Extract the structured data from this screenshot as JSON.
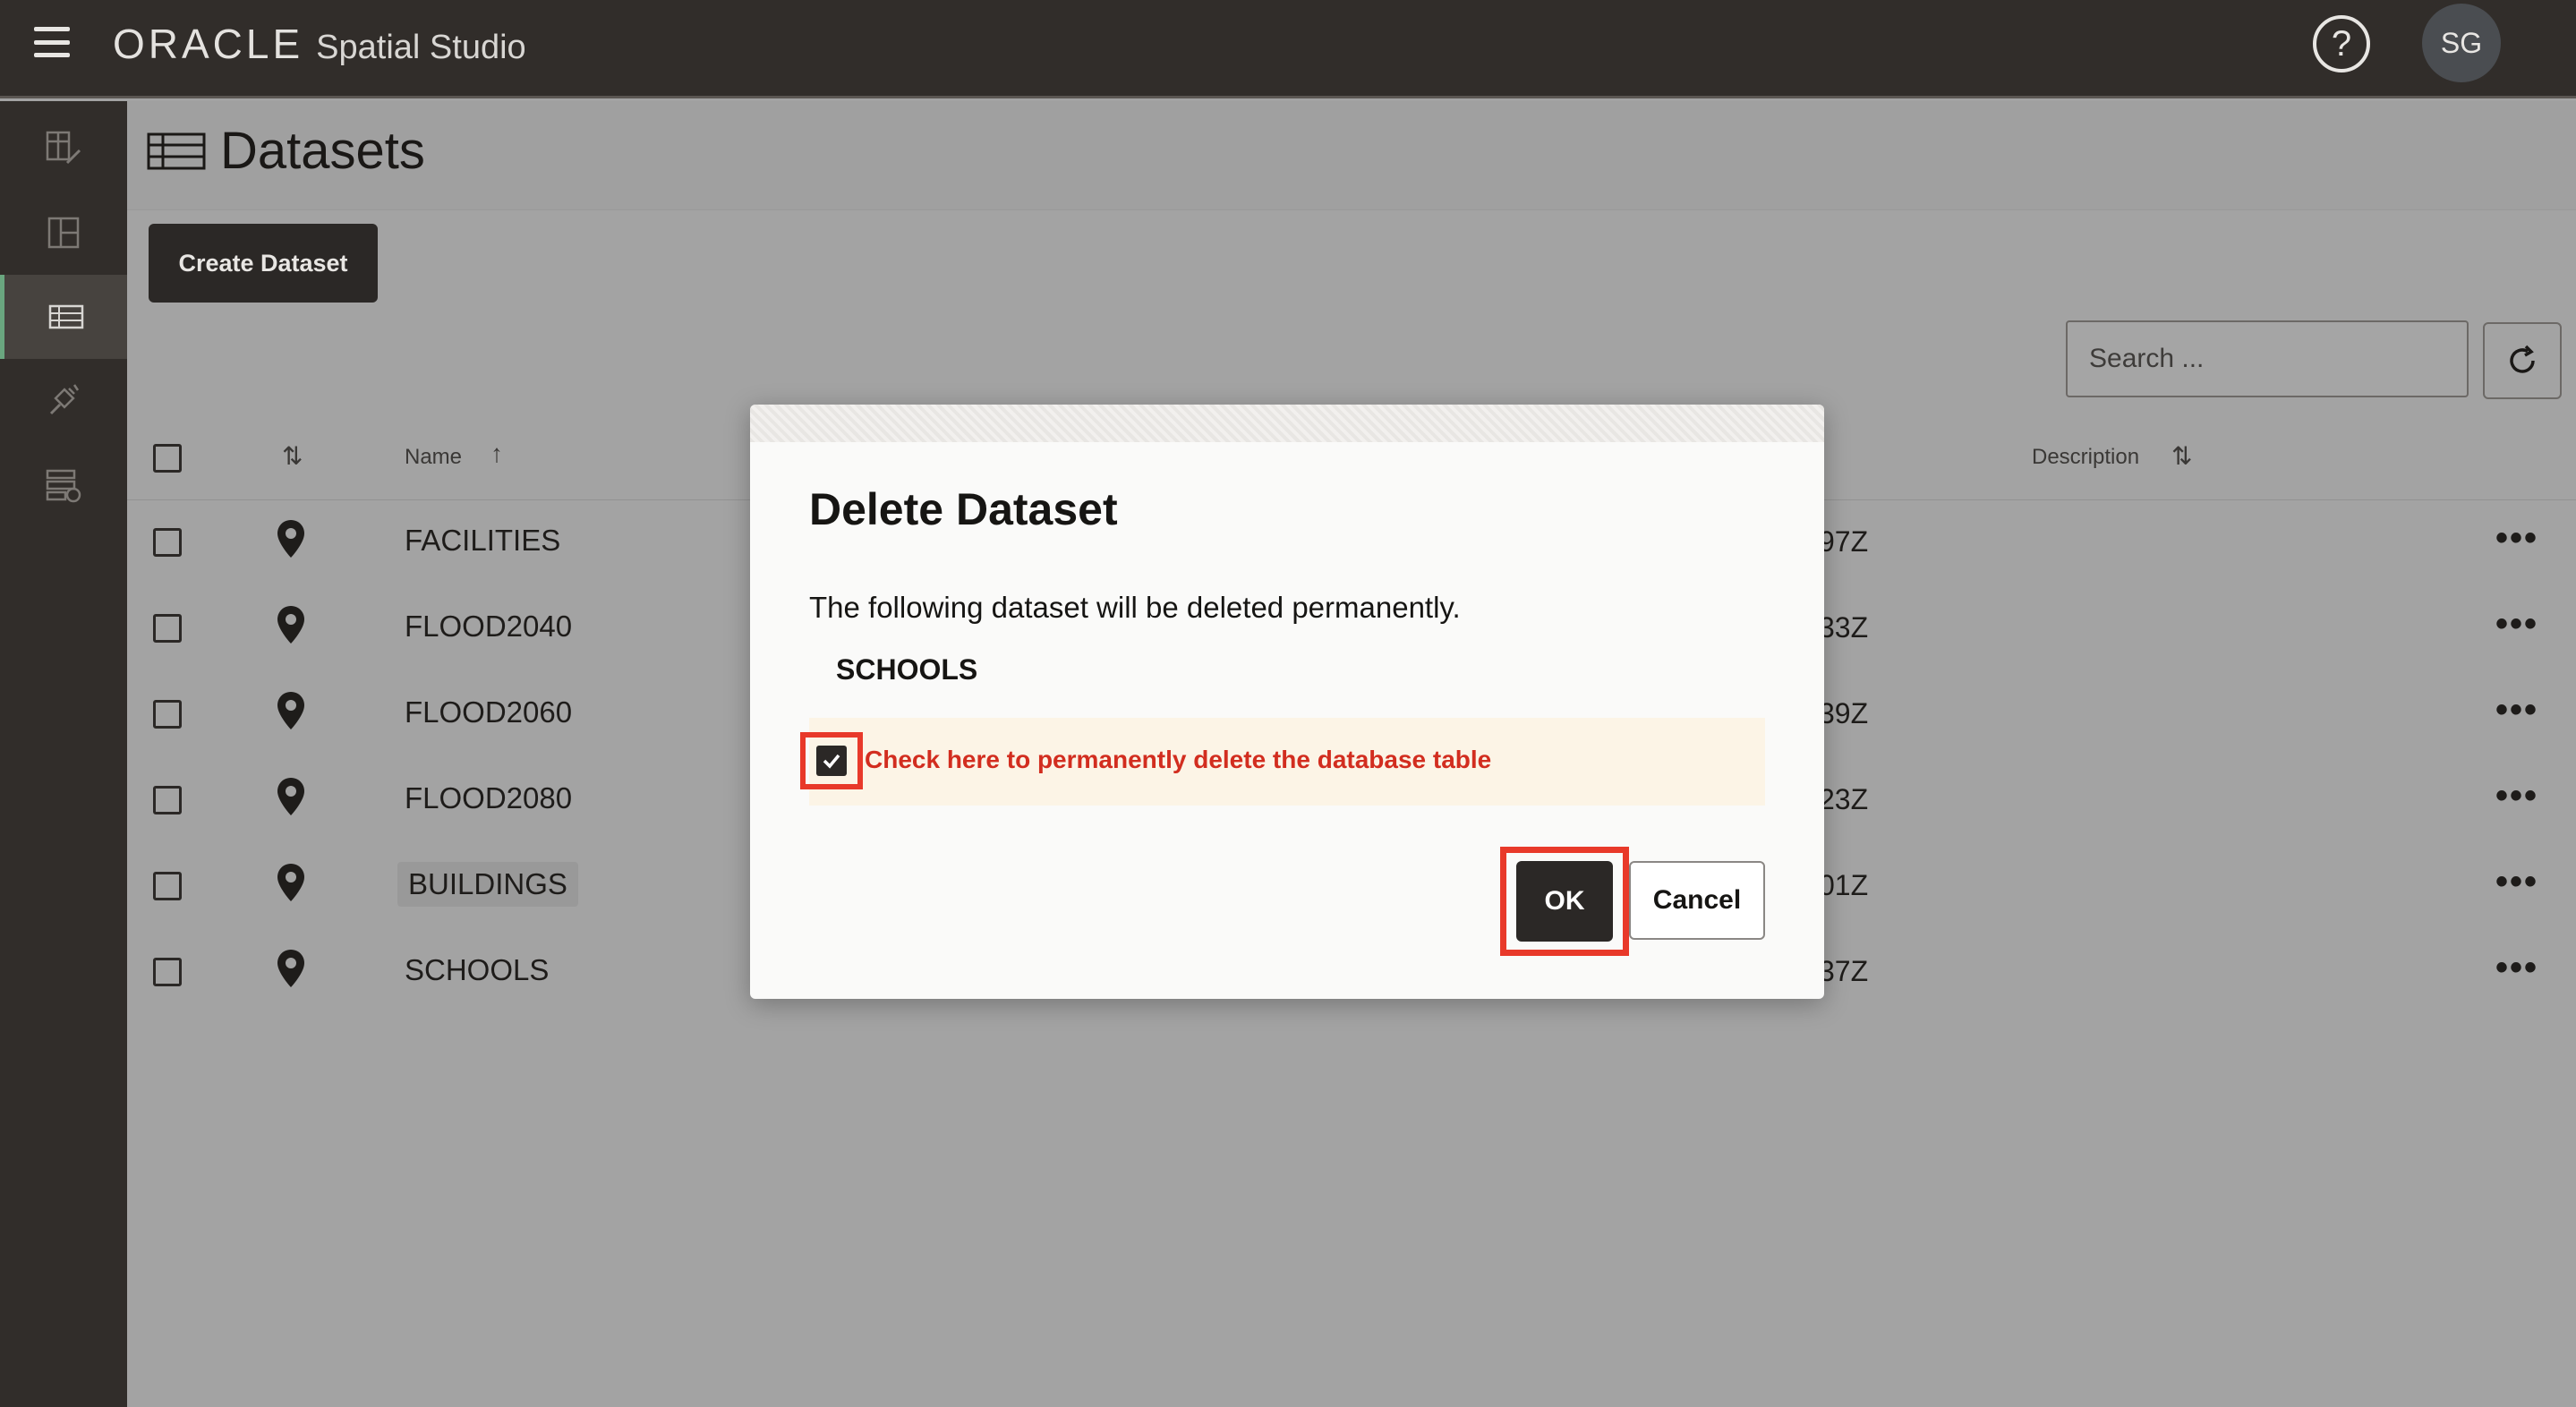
{
  "app": {
    "brand_oracle": "ORACLE",
    "brand_product": "Spatial Studio",
    "help_symbol": "?",
    "avatar_initials": "SG"
  },
  "sidebar": {
    "items": [
      {
        "icon": "project-edit-icon"
      },
      {
        "icon": "layout-icon"
      },
      {
        "icon": "table-icon",
        "active": true
      },
      {
        "icon": "plug-connection-icon"
      },
      {
        "icon": "server-schedule-icon"
      }
    ]
  },
  "page": {
    "title": "Datasets",
    "create_label": "Create Dataset",
    "search_placeholder": "Search ..."
  },
  "table": {
    "col_name": "Name",
    "col_description": "Description",
    "rows": [
      {
        "name": "FACILITIES",
        "date_fragment": "97Z"
      },
      {
        "name": "FLOOD2040",
        "date_fragment": "33Z"
      },
      {
        "name": "FLOOD2060",
        "date_fragment": "39Z"
      },
      {
        "name": "FLOOD2080",
        "date_fragment": "23Z"
      },
      {
        "name": "BUILDINGS",
        "date_fragment": "01Z"
      },
      {
        "name": "SCHOOLS",
        "date_fragment": "37Z"
      }
    ],
    "row_menu": "•••"
  },
  "dialog": {
    "title": "Delete Dataset",
    "message": "The following dataset will be deleted permanently.",
    "dataset": "SCHOOLS",
    "checkbox_label": "Check here to permanently delete the database table",
    "checkbox_checked": true,
    "ok_label": "OK",
    "cancel_label": "Cancel"
  },
  "colors": {
    "header_bg": "#312d2a",
    "overlay_bg": "#a3a3a3",
    "highlight": "#e8392a",
    "warning_text": "#d22d1f",
    "accent_active": "#6aa67f"
  }
}
